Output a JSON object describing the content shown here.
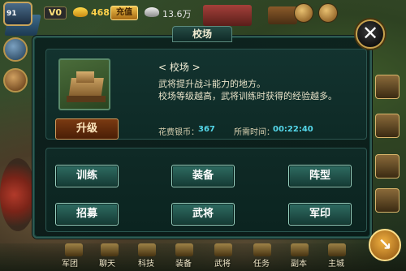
{
  "hud": {
    "level": "91",
    "vip": "V0",
    "gold": "468",
    "recharge_label": "充值",
    "silver": "13.6万"
  },
  "dialog": {
    "title": "校场",
    "close_icon": "close-icon",
    "building": {
      "name": "< 校场 >",
      "desc_lines": [
        "武将提升战斗能力的地方。",
        "校场等级越高，武将训练时获得的经验越多。"
      ],
      "upgrade_label": "升级",
      "cost_label": "花费银币：",
      "cost_value": "367",
      "time_label": "所需时间：",
      "time_value": "00:22:40"
    },
    "buttons": [
      "训练",
      "装备",
      "阵型",
      "招募",
      "武将",
      "军印"
    ]
  },
  "bottom_nav": {
    "items": [
      "军团",
      "聊天",
      "科技",
      "装备",
      "武将",
      "任务",
      "副本",
      "主城"
    ]
  },
  "colors": {
    "panel_bg": "#0e2a26",
    "button_teal": "#2f6c62",
    "upgrade_brown": "#7a3a12",
    "value_cyan": "#54d6e8",
    "gold_border": "#c8a24e"
  }
}
